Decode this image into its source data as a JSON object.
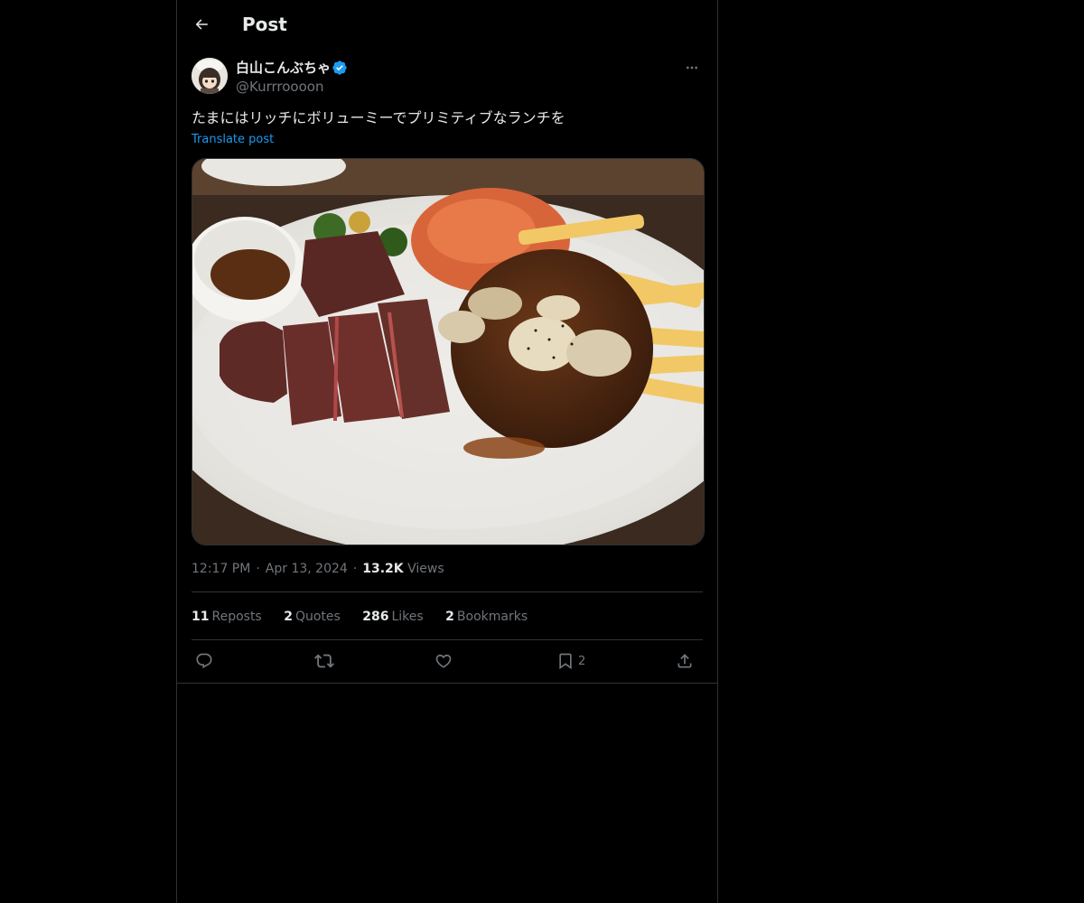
{
  "header": {
    "title": "Post",
    "back_icon": "arrow-left-icon"
  },
  "author": {
    "display_name": "白山こんぶちゃ",
    "handle": "@Kurrroooon",
    "verified": true,
    "verified_color": "#1d9bf0"
  },
  "post": {
    "text": "たまにはリッチにボリューミーでプリミティブなランチを",
    "translate_label": "Translate post",
    "media_description": "photo-steak-hamburg-plate"
  },
  "meta": {
    "time": "12:17 PM",
    "separator": "·",
    "date": "Apr 13, 2024",
    "views_count": "13.2K",
    "views_label": "Views"
  },
  "stats": {
    "reposts_count": "11",
    "reposts_label": "Reposts",
    "quotes_count": "2",
    "quotes_label": "Quotes",
    "likes_count": "286",
    "likes_label": "Likes",
    "bookmarks_count": "2",
    "bookmarks_label": "Bookmarks"
  },
  "actions": {
    "reply_icon": "reply-icon",
    "repost_icon": "repost-icon",
    "like_icon": "heart-icon",
    "bookmark_icon": "bookmark-icon",
    "bookmark_count": "2",
    "share_icon": "share-icon"
  },
  "colors": {
    "background": "#000000",
    "text_primary": "#e7e9ea",
    "text_secondary": "#71767b",
    "accent": "#1d9bf0",
    "border": "#2f3336"
  }
}
